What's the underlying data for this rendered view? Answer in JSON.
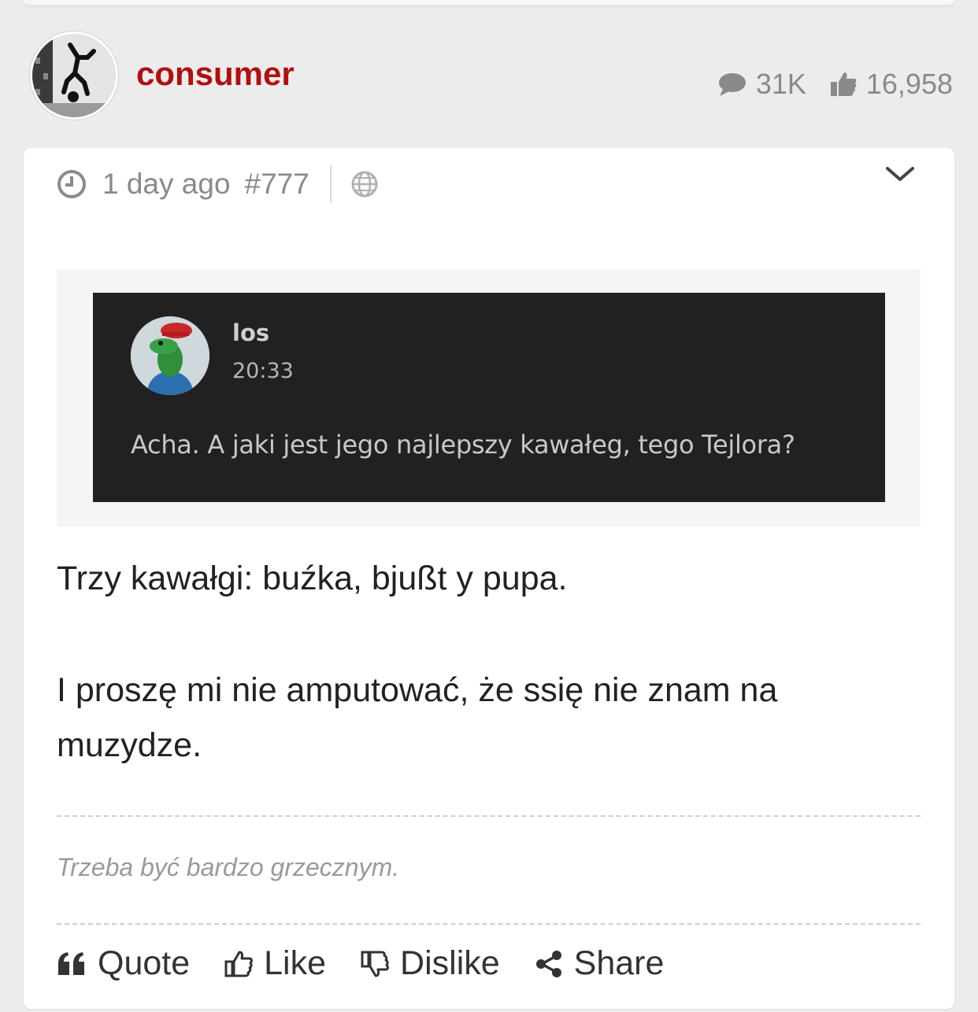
{
  "post": {
    "author": "consumer",
    "stats": {
      "comments": "31K",
      "likes": "16,958"
    },
    "time_ago": "1 day ago",
    "post_number": "#777",
    "quote": {
      "name": "los",
      "time": "20:33",
      "text": "Acha. A jaki jest jego najlepszy kawałeg, tego Tejlora?"
    },
    "body": [
      "Trzy kawałgi: buźka, bjußt y pupa.",
      "I proszę mi nie amputować, że ssię nie znam na muzydze."
    ],
    "signature": "Trzeba być bardzo grzecznym.",
    "actions": {
      "quote": "Quote",
      "like": "Like",
      "dislike": "Dislike",
      "share": "Share"
    }
  },
  "colors": {
    "author": "#b01010",
    "muted": "#8a8a8a",
    "quote_bg": "#212121"
  },
  "icons": [
    "comment-icon",
    "thumbs-up-icon",
    "clock-icon",
    "globe-icon",
    "chevron-down-icon",
    "quote-icon",
    "thumbs-down-icon",
    "share-icon"
  ]
}
